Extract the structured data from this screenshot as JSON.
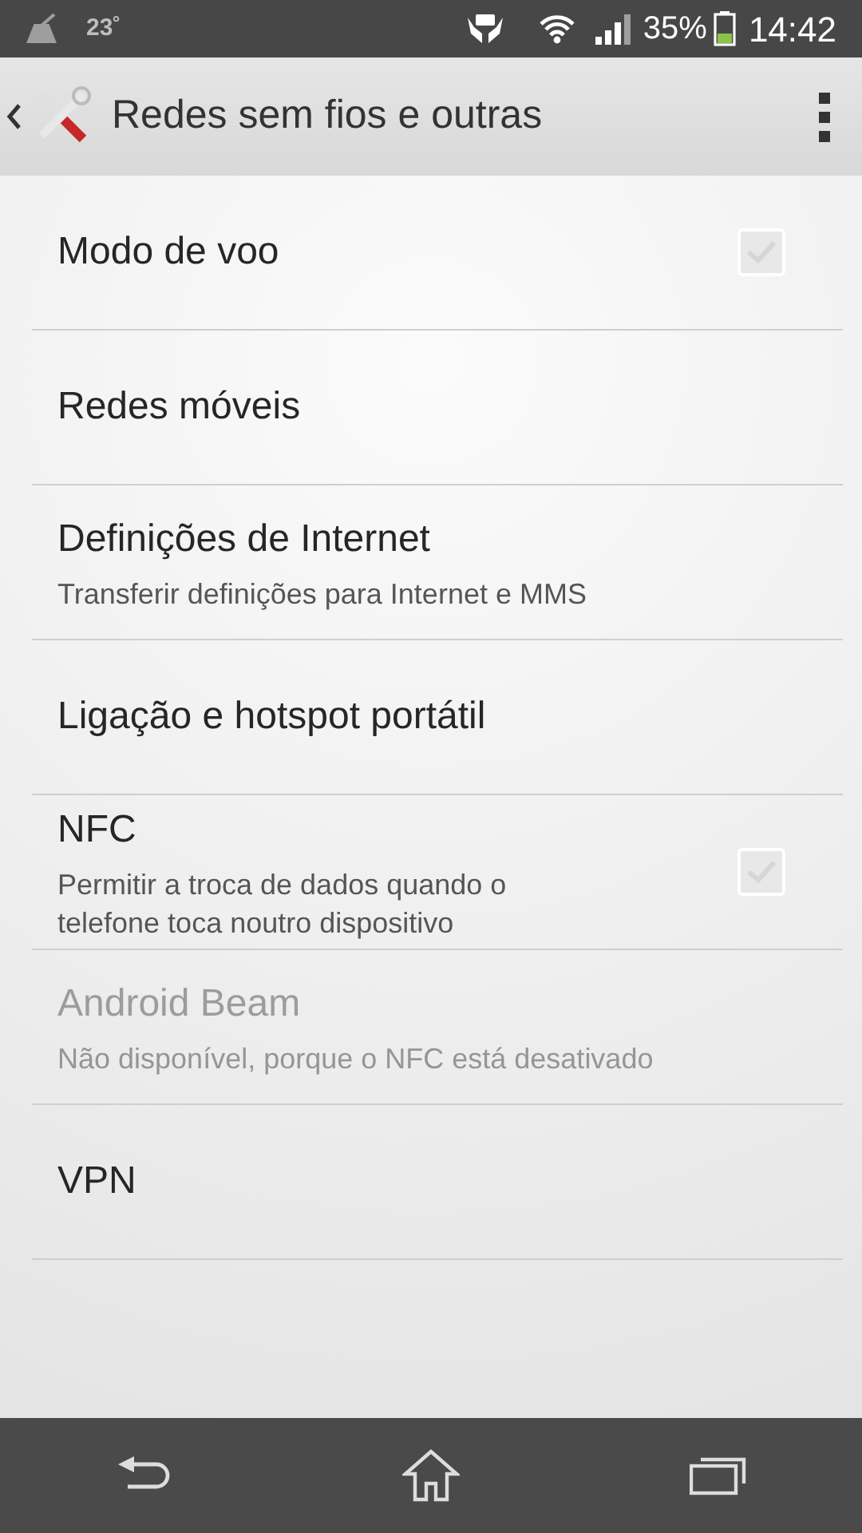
{
  "status_bar": {
    "temperature": "23˚",
    "battery": "35%",
    "time": "14:42"
  },
  "action_bar": {
    "title": "Redes sem fios e outras"
  },
  "items": [
    {
      "kind": "checkbox",
      "title": "Modo de voo",
      "disabled": false,
      "checked": false
    },
    {
      "kind": "plain",
      "title": "Redes móveis",
      "disabled": false
    },
    {
      "kind": "plain",
      "title": "Definições de Internet",
      "summary": "Transferir definições para Internet e MMS",
      "disabled": false
    },
    {
      "kind": "plain",
      "title": "Ligação e hotspot portátil",
      "disabled": false
    },
    {
      "kind": "checkbox",
      "title": "NFC",
      "summary": "Permitir a troca de dados quando o telefone toca noutro dispositivo",
      "disabled": false,
      "checked": false
    },
    {
      "kind": "plain",
      "title": "Android Beam",
      "summary": "Não disponível, porque o NFC está desativado",
      "disabled": true
    },
    {
      "kind": "plain",
      "title": "VPN",
      "disabled": false
    }
  ]
}
